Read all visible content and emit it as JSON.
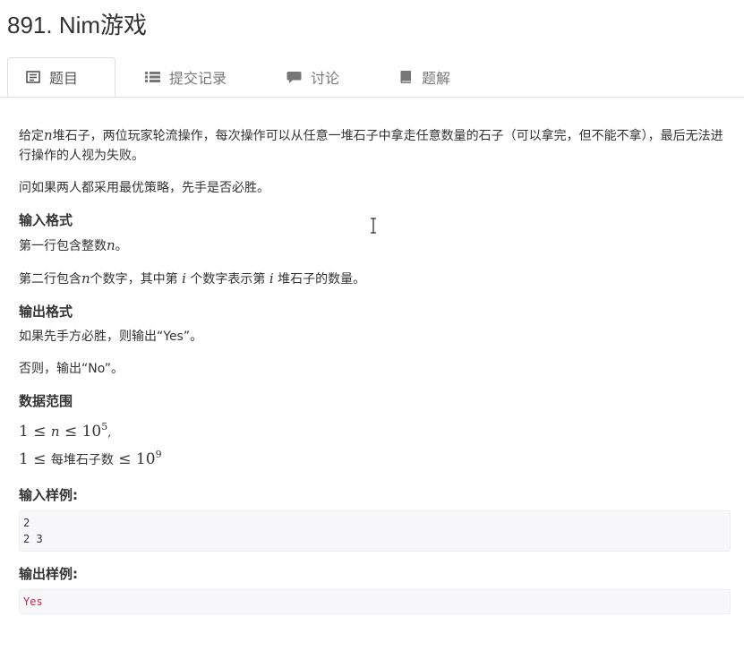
{
  "problem": {
    "title": "891. Nim游戏"
  },
  "tabs": [
    {
      "label": "题目",
      "icon": "document-icon",
      "active": true
    },
    {
      "label": "提交记录",
      "icon": "list-icon",
      "active": false
    },
    {
      "label": "讨论",
      "icon": "comment-icon",
      "active": false
    },
    {
      "label": "题解",
      "icon": "book-icon",
      "active": false
    }
  ],
  "statement": {
    "p1_a": "给定",
    "p1_var": "n",
    "p1_b": "堆石子，两位玩家轮流操作，每次操作可以从任意一堆石子中拿走任意数量的石子（可以拿完，但不能不拿），最后无法进行操作的人视为失败。",
    "p2": "问如果两人都采用最优策略，先手是否必胜。"
  },
  "input_format": {
    "heading": "输入格式",
    "line1_a": "第一行包含整数",
    "line1_var": "n",
    "line1_b": "。",
    "line2_a": "第二行包含",
    "line2_var": "n",
    "line2_b": "个数字，其中第 ",
    "line2_var2": "i",
    "line2_c": " 个数字表示第 ",
    "line2_var3": "i",
    "line2_d": " 堆石子的数量。"
  },
  "output_format": {
    "heading": "输出格式",
    "line1": "如果先手方必胜，则输出“Yes”。",
    "line2": "否则，输出“No”。"
  },
  "data_range": {
    "heading": "数据范围",
    "r1_a": "1 ≤ ",
    "r1_var": "n",
    "r1_b": " ≤ 10",
    "r1_exp": "5",
    "r1_c": ",",
    "r2_a": "1 ≤ ",
    "r2_text": "每堆石子数",
    "r2_b": " ≤ 10",
    "r2_exp": "9"
  },
  "sample_input": {
    "heading": "输入样例:",
    "lines": [
      "2",
      "2 3"
    ]
  },
  "sample_output": {
    "heading": "输出样例:",
    "lines": [
      "Yes"
    ]
  },
  "colors": {
    "accent": "#c7254e",
    "tab_border": "#dddddd",
    "code_bg": "#f7f7f9"
  }
}
